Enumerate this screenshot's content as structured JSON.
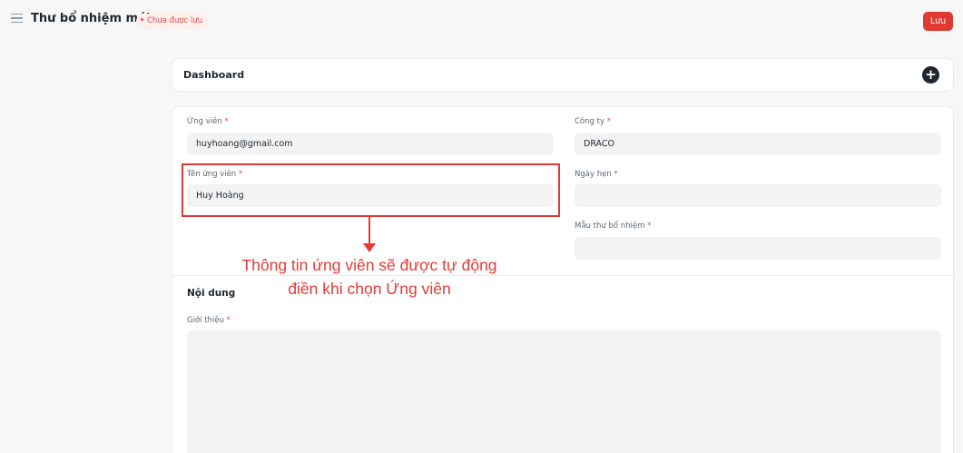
{
  "header": {
    "title": "Thư bổ nhiệm mới",
    "status": "Chưa được lưu",
    "save_label": "Lưu"
  },
  "dashboard": {
    "label": "Dashboard",
    "add_icon": "+"
  },
  "form": {
    "candidate": {
      "label": "Ứng viên",
      "required": "*",
      "value": "huyhoang@gmail.com"
    },
    "company": {
      "label": "Công ty",
      "required": "*",
      "value": "DRACO"
    },
    "candidate_name": {
      "label": "Tên ứng viên",
      "required": "*",
      "value": "Huy Hoàng"
    },
    "appointment_date": {
      "label": "Ngày hẹn",
      "required": "*",
      "value": ""
    },
    "template": {
      "label": "Mẫu thư bổ nhiệm",
      "required": "*",
      "value": ""
    },
    "content_section": "Nội dung",
    "intro": {
      "label": "Giới thiệu",
      "required": "*"
    }
  },
  "annotation": {
    "line1": "Thông tin ứng viên sẽ được tự động",
    "line2": "điền khi chọn Ứng viên",
    "color": "#e53935"
  },
  "colors": {
    "accent": "#e03a31",
    "field_bg": "#f3f3f4"
  }
}
